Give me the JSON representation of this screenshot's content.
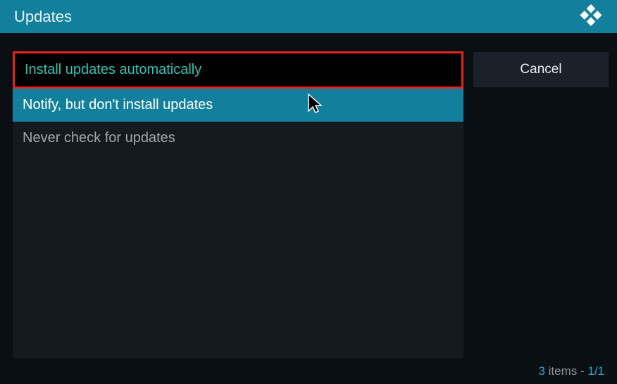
{
  "header": {
    "title": "Updates"
  },
  "options": [
    {
      "label": "Install updates automatically",
      "state": "selected"
    },
    {
      "label": "Notify, but don't install updates",
      "state": "highlighted"
    },
    {
      "label": "Never check for updates",
      "state": "normal"
    }
  ],
  "sidebar": {
    "cancel_label": "Cancel"
  },
  "footer": {
    "count": "3",
    "items_label": " items - ",
    "page": "1/1"
  }
}
